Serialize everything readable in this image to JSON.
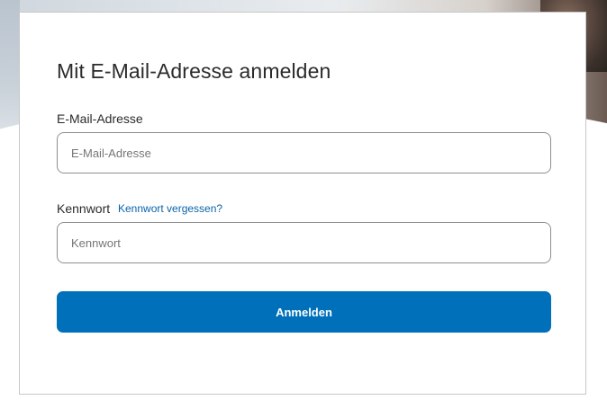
{
  "form": {
    "title": "Mit E-Mail-Adresse anmelden",
    "email_label": "E-Mail-Adresse",
    "email_placeholder": "E-Mail-Adresse",
    "email_value": "",
    "password_label": "Kennwort",
    "forgot_link": "Kennwort vergessen?",
    "password_placeholder": "Kennwort",
    "password_value": "",
    "submit_label": "Anmelden"
  },
  "colors": {
    "primary": "#0070ba",
    "link": "#0a63a8",
    "text": "#2b2b2b",
    "border": "#8e8e8e"
  }
}
